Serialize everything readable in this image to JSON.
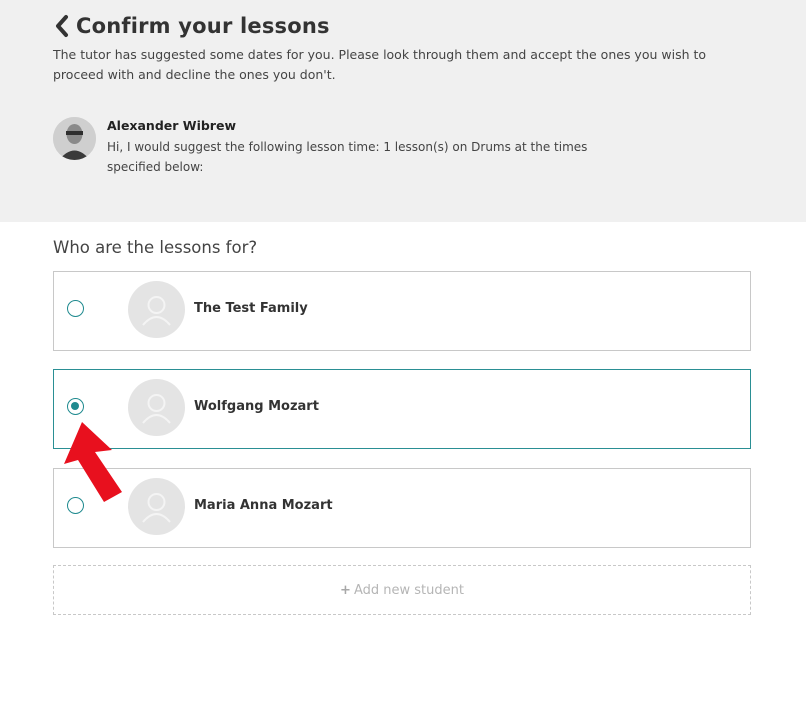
{
  "header": {
    "title": "Confirm your lessons",
    "intro": "The tutor has suggested some dates for you. Please look through them and accept the ones you wish to proceed with and decline the ones you don't.",
    "back_icon": "chevron-left-icon"
  },
  "tutor": {
    "name": "Alexander Wibrew",
    "message": "Hi, I would suggest the following lesson time: 1 lesson(s) on Drums at the times specified below:"
  },
  "students": {
    "heading": "Who are the lessons for?",
    "items": [
      {
        "name": "The Test Family",
        "selected": false
      },
      {
        "name": "Wolfgang Mozart",
        "selected": true
      },
      {
        "name": "Maria Anna Mozart",
        "selected": false
      }
    ],
    "add_icon": "+",
    "add_label": "Add new student"
  },
  "colors": {
    "accent": "#1f8a8f",
    "header_bg": "#f0f0f0",
    "annotation_arrow": "#e8101e"
  }
}
